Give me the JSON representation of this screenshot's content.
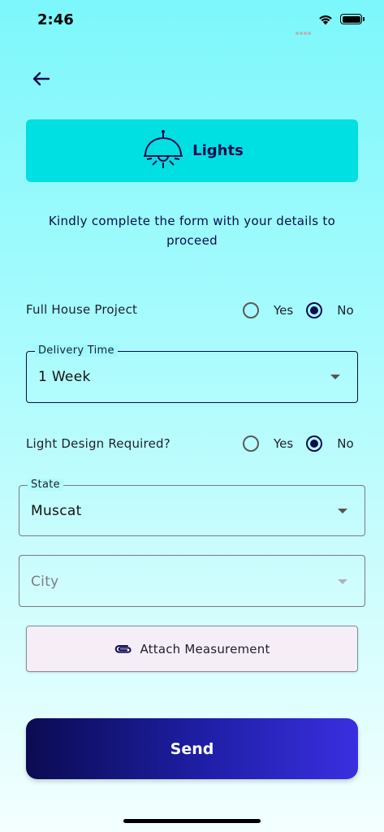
{
  "status_bar": {
    "time": "2:46"
  },
  "category": {
    "title": "Lights",
    "icon": "ceiling-lamp-icon"
  },
  "intro_text": "Kindly complete the form with your details to proceed",
  "full_house_project": {
    "label": "Full House Project",
    "options": [
      "Yes",
      "No"
    ],
    "selected": "No"
  },
  "delivery_time": {
    "legend": "Delivery Time",
    "value": "1 Week"
  },
  "light_design": {
    "label": "Light Design Required?",
    "options": [
      "Yes",
      "No"
    ],
    "selected": "No"
  },
  "state": {
    "legend": "State",
    "value": "Muscat"
  },
  "city": {
    "placeholder": "City"
  },
  "attach": {
    "label": "Attach Measurement",
    "icon": "paperclip-icon"
  },
  "send": {
    "label": "Send"
  },
  "colors": {
    "accent": "#00e0e3",
    "navy": "#0d0d4f",
    "send_gradient_start": "#0b0b52",
    "send_gradient_end": "#3a2fe0"
  }
}
